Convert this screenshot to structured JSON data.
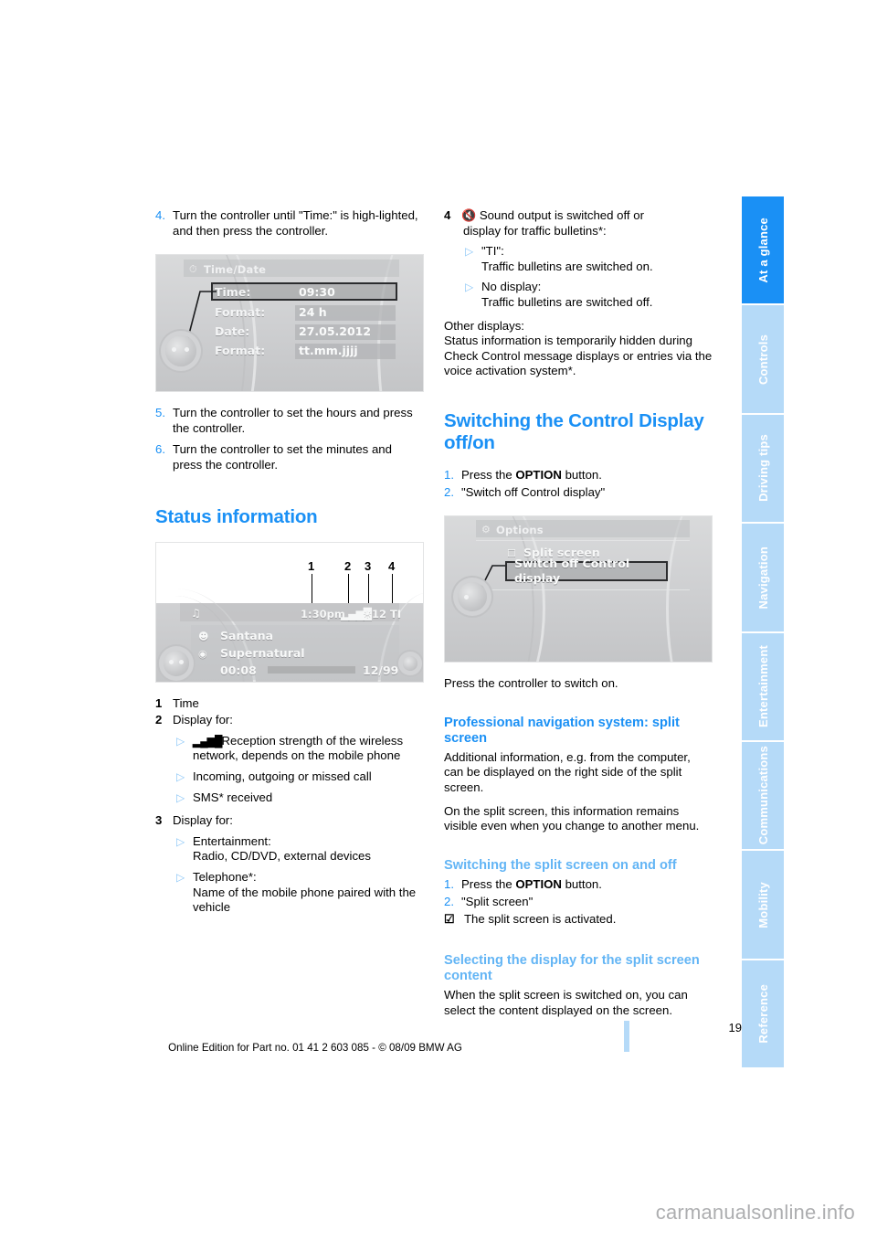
{
  "page": {
    "number": "19",
    "footer": "Online Edition for Part no. 01 41 2 603 085 - © 08/09 BMW AG",
    "watermark": "carmanualsonline.info"
  },
  "sidebar": {
    "items": [
      {
        "label": "At a glance",
        "active": true
      },
      {
        "label": "Controls",
        "active": false
      },
      {
        "label": "Driving tips",
        "active": false
      },
      {
        "label": "Navigation",
        "active": false
      },
      {
        "label": "Entertainment",
        "active": false
      },
      {
        "label": "Communications",
        "active": false
      },
      {
        "label": "Mobility",
        "active": false
      },
      {
        "label": "Reference",
        "active": false
      }
    ]
  },
  "left_column": {
    "step4": {
      "num": "4.",
      "text": "Turn the controller until \"Time:\" is high-lighted, and then press the controller."
    },
    "timedate_shot": {
      "title": "Time/Date",
      "rows": [
        {
          "label": "Time:",
          "value": "09:30",
          "highlighted": true
        },
        {
          "label": "Format:",
          "value": "24 h",
          "highlighted": false
        },
        {
          "label": "Date:",
          "value": "27.05.2012",
          "highlighted": false
        },
        {
          "label": "Format:",
          "value": "tt.mm.jjjj",
          "highlighted": false
        }
      ]
    },
    "step5": {
      "num": "5.",
      "text": "Turn the controller to set the hours and press the controller."
    },
    "step6": {
      "num": "6.",
      "text": "Turn the controller to set the minutes and press the controller."
    },
    "heading_status": "Status information",
    "status_shot": {
      "callouts": [
        "1",
        "2",
        "3",
        "4"
      ],
      "status_time": "1:30pm",
      "status_bars": "▂▄▆█",
      "status_tempicon": "☀",
      "status_temp": "12",
      "status_ti": "TI",
      "artist": "Santana",
      "album": "Supernatural",
      "elapsed": "00:08",
      "track": "12/99"
    },
    "legend": [
      {
        "num": "1",
        "text": "Time"
      },
      {
        "num": "2",
        "text": "Display for:"
      },
      {
        "num": "3",
        "text": "Display for:"
      }
    ],
    "bullets2": [
      {
        "icon": "signal-bars-icon",
        "text": "Reception strength of the wireless network, depends on the mobile phone"
      },
      {
        "icon": "",
        "text": "Incoming, outgoing or missed call"
      },
      {
        "icon": "",
        "text": "SMS* received",
        "star": true
      }
    ],
    "bullets3": [
      {
        "text_line1": "Entertainment:",
        "text_line2": "Radio, CD/DVD, external devices"
      },
      {
        "text_line1": "Telephone*:",
        "text_line2": "Name of the mobile phone paired with the vehicle",
        "star": true
      }
    ]
  },
  "right_column": {
    "legend4": {
      "num": "4",
      "icon": "mute-icon",
      "line1": "Sound output is switched off or",
      "line2": "display for traffic bulletins*:"
    },
    "bullets4": [
      {
        "line1": "\"TI\":",
        "line2": "Traffic bulletins are switched on."
      },
      {
        "line1": "No display:",
        "line2": "Traffic bulletins are switched off."
      }
    ],
    "other_displays_label": "Other displays:",
    "other_displays_text": "Status information is temporarily hidden during Check Control message displays or entries via the voice activation system*.",
    "heading_switching": "Switching the Control Display off/on",
    "steps_switching": [
      {
        "num": "1.",
        "pre": "Press the ",
        "bold": "OPTION",
        "post": " button."
      },
      {
        "num": "2.",
        "pre": "\"Switch off Control display\"",
        "bold": "",
        "post": ""
      }
    ],
    "options_shot": {
      "title": "Options",
      "item1": "Split screen",
      "item2_highlighted": "Switch off Control display"
    },
    "press_controller": "Press the controller to switch on.",
    "heading_profnav": "Professional navigation system: split screen",
    "profnav_p1": "Additional information, e.g. from the computer, can be displayed on the right side of the split screen.",
    "profnav_p2": "On the split screen, this information remains visible even when you change to another menu.",
    "heading_split_onoff": "Switching the split screen on and off",
    "steps_split": [
      {
        "num": "1.",
        "pre": "Press the ",
        "bold": "OPTION",
        "post": " button."
      },
      {
        "num": "2.",
        "pre": "\"Split screen\"",
        "bold": "",
        "post": ""
      }
    ],
    "split_activated": "The split screen is activated.",
    "heading_select_display": "Selecting the display for the split screen content",
    "select_display_text": "When the split screen is switched on, you can select the content displayed on the screen."
  },
  "colors": {
    "accent": "#1a90f5",
    "accent_light": "#63b5f5",
    "tab_inactive": "#b5daf8",
    "bullet": "#8ec8f7"
  }
}
